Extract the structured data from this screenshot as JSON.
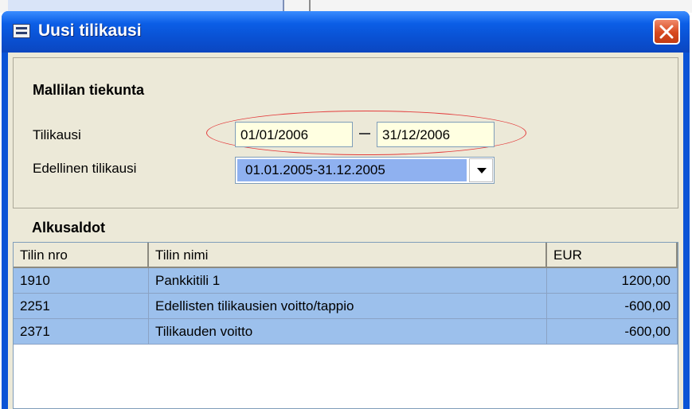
{
  "window": {
    "title": "Uusi tilikausi"
  },
  "company": {
    "name": "Mallilan tiekunta"
  },
  "period": {
    "label": "Tilikausi",
    "start": "01/01/2006",
    "end": "31/12/2006"
  },
  "previous_period": {
    "label": "Edellinen tilikausi",
    "selected": "01.01.2005-31.12.2005"
  },
  "opening_balances": {
    "title": "Alkusaldot",
    "columns": [
      "Tilin nro",
      "Tilin nimi",
      "EUR"
    ],
    "rows": [
      {
        "account": "1910",
        "name": "Pankkitili 1",
        "amount": "1200,00"
      },
      {
        "account": "2251",
        "name": "Edellisten tilikausien voitto/tappio",
        "amount": "-600,00"
      },
      {
        "account": "2371",
        "name": "Tilikauden voitto",
        "amount": "-600,00"
      }
    ]
  },
  "colors": {
    "titlebar": "#0a4fd0",
    "row_highlight": "#9cc0ec",
    "date_field": "#ffffe1",
    "annotation_oval": "#e33b3b",
    "close_button": "#d8491f"
  },
  "icons": {
    "window": "window-menu-icon",
    "close": "close-icon",
    "dropdown": "chevron-down-icon"
  }
}
